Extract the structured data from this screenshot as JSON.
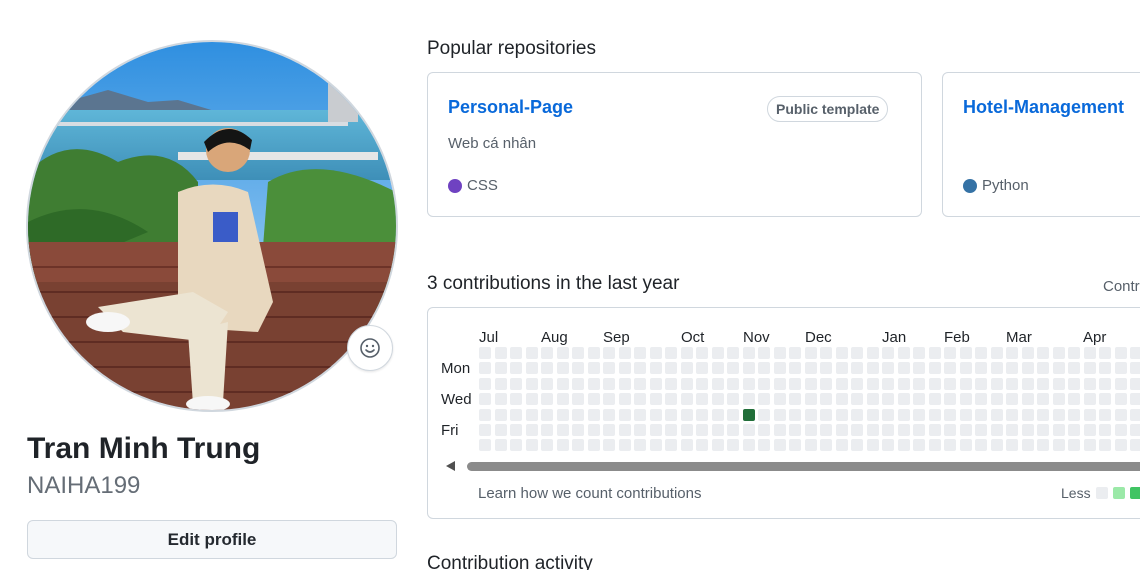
{
  "profile": {
    "name": "Tran Minh Trung",
    "login": "NAIHA199",
    "edit_label": "Edit profile",
    "status_icon": "smiley-icon"
  },
  "popular": {
    "title": "Popular repositories",
    "repos": [
      {
        "name": "Personal-Page",
        "badge": "Public template",
        "description": "Web cá nhân",
        "language": "CSS",
        "language_color": "#6f42c1"
      },
      {
        "name": "Hotel-Management",
        "badge": "",
        "description": "",
        "language": "Python",
        "language_color": "#3572A5"
      }
    ]
  },
  "contributions": {
    "title": "3 contributions in the last year",
    "settings_label": "Contr",
    "months": [
      "Jul",
      "Aug",
      "Sep",
      "Oct",
      "Nov",
      "Dec",
      "Jan",
      "Feb",
      "Mar",
      "Apr"
    ],
    "days": [
      "Mon",
      "Wed",
      "Fri"
    ],
    "learn_label": "Learn how we count contributions",
    "legend_less": "Less",
    "colors": {
      "empty": "#ebedf0",
      "level1": "#9be9a8",
      "level2": "#40c463",
      "level4": "#216e39"
    },
    "active_cell": {
      "week": 17,
      "weekday": 4,
      "level": 4
    }
  },
  "activity": {
    "title": "Contribution activity"
  }
}
